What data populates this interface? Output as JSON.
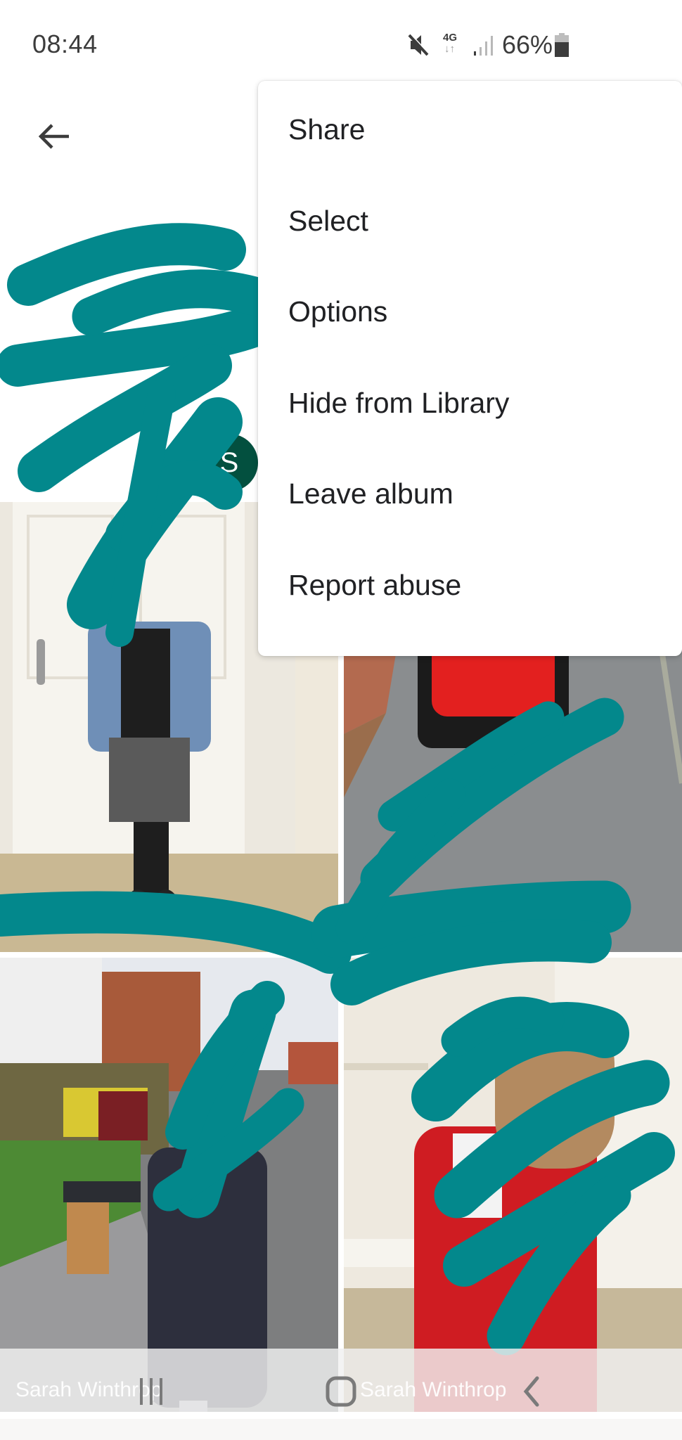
{
  "status_bar": {
    "time": "08:44",
    "network": "4G",
    "battery_percent": "66%",
    "icons": [
      "mute-icon",
      "data-4g-icon",
      "signal-icon",
      "battery-icon"
    ]
  },
  "header": {
    "back_icon": "arrow-back-icon",
    "avatar_initial": "S",
    "avatar_color": "#03503f"
  },
  "menu": {
    "items": [
      {
        "label": "Share"
      },
      {
        "label": "Select"
      },
      {
        "label": "Options"
      },
      {
        "label": "Hide from Library"
      },
      {
        "label": "Leave album"
      },
      {
        "label": "Report abuse"
      }
    ]
  },
  "photos": [
    {
      "description": "Child in denim jacket and gingham skirt by door"
    },
    {
      "description": "Child with red backpack on pavement"
    },
    {
      "description": "Child in navy coat by garden wall"
    },
    {
      "description": "Child in red school cardigan"
    }
  ],
  "photo_owners": [
    "Sarah Winthrop",
    "Sarah Winthrop"
  ],
  "redaction_color": "#03888c",
  "nav_bar": {
    "icons": [
      "recent-apps-icon",
      "home-icon",
      "back-icon"
    ]
  }
}
